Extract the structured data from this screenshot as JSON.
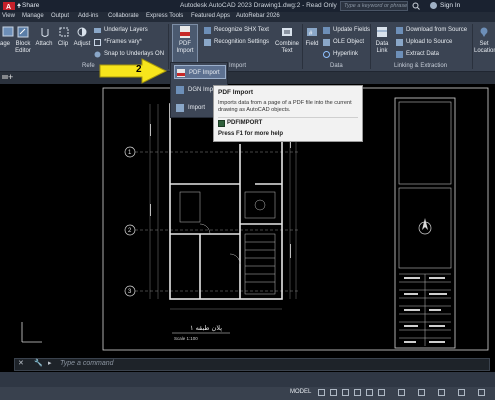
{
  "titlebar": {
    "share": "Share",
    "title": "Autodesk AutoCAD 2023   Drawing1.dwg:2 - Read Only",
    "search_placeholder": "Type a keyword or phrase",
    "signin": "Sign In"
  },
  "menu": {
    "tabs": [
      "View",
      "Manage",
      "Output",
      "Add-ins",
      "Collaborate",
      "Express Tools",
      "Featured Apps",
      "AutoRebar 2026"
    ]
  },
  "ribbon": {
    "image": "age",
    "block_editor": "Block\nEditor",
    "attach": "Attach",
    "clip": "Clip",
    "adjust": "Adjust",
    "underlay_layers": "Underlay Layers",
    "frames_vary": "*Frames vary*",
    "snap_underlays": "Snap to Underlays ON",
    "pdf_import": "PDF\nImport",
    "recognize_shx": "Recognize SHX Text",
    "recognition_settings": "Recognition Settings",
    "combine_text": "Combine\nText",
    "field": "Field",
    "update_fields": "Update Fields",
    "ole_object": "OLE Object",
    "hyperlink": "Hyperlink",
    "data_link": "Data\nLink",
    "download_source": "Download from Source",
    "upload_source": "Upload to Source",
    "extract_data": "Extract  Data",
    "set_location": "Set\nLocation",
    "panel_reference": "Refe",
    "panel_import": "Import",
    "panel_data": "Data",
    "panel_linking": "Linking & Extraction"
  },
  "dropdown": {
    "items": [
      "PDF Import",
      "DGN Imp",
      "Import"
    ]
  },
  "tooltip": {
    "title": "PDF Import",
    "description": "Imports data from a page of a PDF file into the current drawing as AutoCAD objects.",
    "command": "PDFIMPORT",
    "help": "Press F1 for more help"
  },
  "callout": {
    "number": "2"
  },
  "drawing": {
    "grid_labels": [
      "1",
      "2",
      "3"
    ],
    "plan_caption": "پلان طبقه ۱",
    "scale": "Scale 1:100"
  },
  "commandline": {
    "placeholder": "Type a command",
    "x": "✕",
    "wrench": "🔧",
    "prompt": "▸"
  },
  "status": {
    "model": "MODEL"
  },
  "colors": {
    "background": "#000000",
    "ribbon": "#3b4453",
    "titlebar": "#1a2230",
    "callout_arrow": "#f7e51c",
    "tooltip_bg": "#f2f2f2"
  }
}
